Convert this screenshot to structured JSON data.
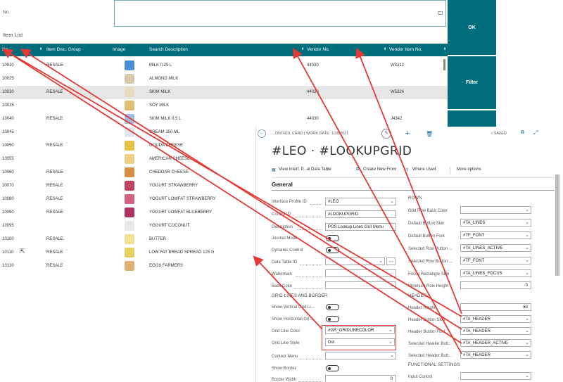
{
  "top": {
    "no_label": "No.",
    "item_list_label": "Item List"
  },
  "buttons": {
    "ok": "OK",
    "filter": "Filter"
  },
  "grid": {
    "headers": {
      "no": "No.",
      "disc": "Item Disc. Group",
      "image": "Image",
      "search": "Search Description",
      "vendor": "Vendor No.",
      "vendor_item": "Vendor Item No."
    },
    "rows": [
      {
        "no": "10020",
        "disc": "RESALE",
        "desc": "MILK 0.25 L",
        "vendor": "44030",
        "vitem": "W3212",
        "thumb": "#4a8fd6"
      },
      {
        "no": "10025",
        "disc": "",
        "desc": "ALMOND MILK",
        "vendor": "",
        "vitem": "",
        "thumb": "#d8c9a8"
      },
      {
        "no": "10030",
        "disc": "RESALE",
        "desc": "SKIM MILK",
        "vendor": "44030",
        "vitem": "W5324",
        "thumb": "#e8dcc0"
      },
      {
        "no": "10035",
        "disc": "",
        "desc": "SOY MILK",
        "vendor": "",
        "vitem": "",
        "thumb": "#e0c070"
      },
      {
        "no": "10040",
        "disc": "RESALE",
        "desc": "SKIM MILK 0.5 L",
        "vendor": "44030",
        "vitem": "J4342",
        "thumb": "#9cc0e0"
      },
      {
        "no": "10045",
        "disc": "",
        "desc": "CREAM 250 ML",
        "vendor": "",
        "vitem": "",
        "thumb": "#e0e6ee"
      },
      {
        "no": "10050",
        "disc": "RESALE",
        "desc": "GOUDA CHEESE",
        "vendor": "",
        "vitem": "",
        "thumb": "#e8c040"
      },
      {
        "no": "10055",
        "disc": "",
        "desc": "AMERICAN CHEESE",
        "vendor": "",
        "vitem": "",
        "thumb": "#f0d080"
      },
      {
        "no": "10060",
        "disc": "RESALE",
        "desc": "CHEDDAR CHEESE",
        "vendor": "",
        "vitem": "",
        "thumb": "#d89040"
      },
      {
        "no": "10070",
        "disc": "RESALE",
        "desc": "YOGURT STRAWBERRY",
        "vendor": "",
        "vitem": "",
        "thumb": "#c04060"
      },
      {
        "no": "10080",
        "disc": "RESALE",
        "desc": "YOGURT LOWFAT STRAWBERRY",
        "vendor": "",
        "vitem": "",
        "thumb": "#d86080"
      },
      {
        "no": "10090",
        "disc": "RESALE",
        "desc": "YOGURT LOWFAT BLUEBERRY",
        "vendor": "",
        "vitem": "",
        "thumb": "#b03060"
      },
      {
        "no": "10095",
        "disc": "",
        "desc": "YOGURT COCONUT",
        "vendor": "",
        "vitem": "",
        "thumb": "#e8e8e8"
      },
      {
        "no": "10100",
        "disc": "RESALE",
        "desc": "BUTTER",
        "vendor": "",
        "vitem": "",
        "thumb": "#f0e090"
      },
      {
        "no": "10110",
        "disc": "RESALE",
        "desc": "LOW FAT BREAD SPREAD 125 G",
        "vendor": "",
        "vitem": "",
        "thumb": "#e8d060"
      },
      {
        "no": "10120",
        "disc": "RESALE",
        "desc": "EGGS FARMERS",
        "vendor": "",
        "vitem": "",
        "thumb": "#e0b070"
      }
    ]
  },
  "card": {
    "breadcrumb": "...ONTROL CARD | WORK DATE: 1/28/2021",
    "saved": "✓SAVED",
    "title": "#LEO · #LOOKUPGRID",
    "actions": {
      "view": "View Interf. P...al Data Table",
      "create": "Create New From",
      "where": "Where Used",
      "more": "More options"
    },
    "section": "General",
    "left": {
      "profile_label": "Interface Profile ID",
      "profile_value": "#LEO",
      "control_label": "Control ID",
      "control_value": "#LOOKUPGRID",
      "desc_label": "Description",
      "desc_value": "POS Lookup Lines GUI Menu",
      "journal_label": "Journal Mode",
      "dynamic_label": "Dynamic Control",
      "datatable_label": "Data Table ID",
      "watermark_label": "Watermark",
      "backcolor_label": "Back Color",
      "gridlines_header": "GRID LINES AND BORDER",
      "show_vert_label": "Show Vertical Grid Li...",
      "show_horiz_label": "Show Horizontal Gri...",
      "gridcolor_label": "Grid Line Color",
      "gridcolor_value": "#GR_GRIDLINECOLOR",
      "gridstyle_label": "Grid Line Style",
      "gridstyle_value": "Dot",
      "context_label": "Context Menu",
      "showborder_label": "Show Border",
      "borderwidth_label": "Border Width",
      "borderwidth_value": "0"
    },
    "right": {
      "rows_header": "ROWS",
      "odd_label": "Odd Row Back Color",
      "odd_value": "",
      "dbs_label": "Default Button Skin",
      "dbs_value": "#TA_LINES",
      "dbf_label": "Default Button Font",
      "dbf_value": "#TF_FONT",
      "srbs_label": "Selected Row Button ...",
      "srbs_value": "#TA_LINES_ACTIVE",
      "srbf_label": "Selected Row Button ...",
      "srbf_value": "#TF_FONT",
      "frs_label": "Focus Rectangle Skin",
      "frs_value": "#TA_LINES_FOCUS",
      "mrh_label": "Minimum Row Height",
      "mrh_value": "0",
      "header_header": "HEADER",
      "hh_label": "Header Height",
      "hh_value": "60",
      "hbs_label": "Header Button Skin",
      "hbs_value": "#TA_HEADER",
      "hbf_label": "Header Button Font",
      "hbf_value": "#TA_HEADER",
      "shb1_label": "Selected Header Butt...",
      "shb1_value": "#TA_HEADER_ACTIVE",
      "shb2_label": "Selected Header Butt...",
      "shb2_value": "#TA_HEADER",
      "func_header": "FUNCTIONAL SETTINGS",
      "input_label": "Input Control",
      "input_value": ""
    }
  },
  "colors": {
    "accent": "#006d7c",
    "arrow": "#e53935",
    "link": "#1a6b9c"
  }
}
